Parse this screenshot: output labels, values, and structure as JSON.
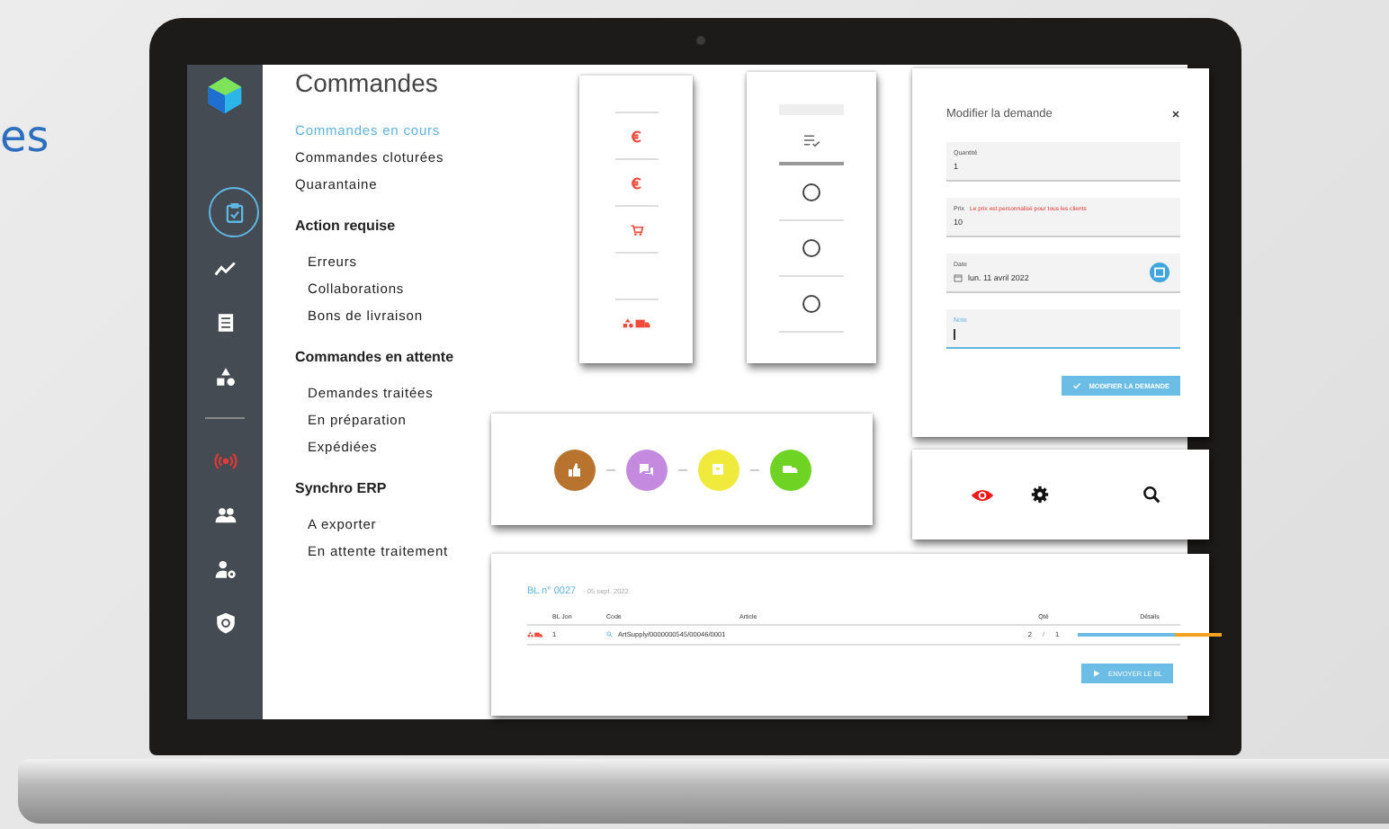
{
  "page_text": "es",
  "sidebar": {
    "groups": [
      {
        "items": [
          {
            "kind": "orders",
            "selected": true
          },
          {
            "kind": "stats",
            "selected": false
          },
          {
            "kind": "document",
            "selected": false
          },
          {
            "kind": "shapes",
            "selected": false
          }
        ]
      },
      {
        "items": [
          {
            "kind": "signal",
            "selected": false
          },
          {
            "kind": "people",
            "selected": false
          },
          {
            "kind": "user-settings",
            "selected": false
          },
          {
            "kind": "shield",
            "selected": false
          }
        ]
      }
    ]
  },
  "nav": {
    "title": "Commandes",
    "sections": [
      {
        "items": [
          {
            "label": "Commandes en cours",
            "selected": true
          },
          {
            "label": "Commandes cloturées",
            "selected": false
          },
          {
            "label": "Quarantaine",
            "selected": false
          }
        ]
      },
      {
        "heading": "Action requise",
        "items": [
          {
            "label": "Erreurs",
            "selected": false
          },
          {
            "label": "Collaborations",
            "selected": false
          },
          {
            "label": "Bons de livraison",
            "selected": false
          }
        ]
      },
      {
        "heading": "Commandes en attente",
        "items": [
          {
            "label": "Demandes traitées",
            "selected": false
          },
          {
            "label": "En préparation",
            "selected": false
          },
          {
            "label": "Expédiées",
            "selected": false
          }
        ]
      },
      {
        "heading": "Synchro ERP",
        "items": [
          {
            "label": "A exporter",
            "selected": false
          },
          {
            "label": "En attente traitement",
            "selected": false
          }
        ]
      }
    ]
  },
  "status_card": {
    "rows": [
      {
        "kind": "euro"
      },
      {
        "kind": "euro"
      },
      {
        "kind": "cart"
      },
      {
        "kind": "empty"
      },
      {
        "kind": "delivery"
      }
    ]
  },
  "select_card": {
    "rows": [
      {
        "selected": false
      },
      {
        "selected": false
      },
      {
        "selected": false
      }
    ]
  },
  "modal": {
    "title": "Modifier la demande",
    "fields": [
      {
        "kind": "text",
        "label": "Quantité",
        "value": "1",
        "focused": false
      },
      {
        "kind": "text",
        "label": "Prix",
        "hint": "Le prix est personnalisé pour tous les clients",
        "value": "10",
        "focused": false
      },
      {
        "kind": "date",
        "label": "Date",
        "value": "lun. 11 avril 2022",
        "focused": false
      },
      {
        "kind": "text",
        "label": "Note",
        "focused": true
      }
    ],
    "button": "MODIFIER LA DEMANDE"
  },
  "flow": {
    "steps": [
      {
        "kind": "thumb",
        "color": "#b8732e"
      },
      {
        "kind": "chat",
        "color": "#c48ae0"
      },
      {
        "kind": "box",
        "color": "#f0ea3c"
      },
      {
        "kind": "truck",
        "color": "#6fd324"
      }
    ]
  },
  "actions": [
    {
      "kind": "view",
      "alert": true
    },
    {
      "kind": "settings",
      "alert": false
    },
    {
      "kind": "search",
      "alert": false
    }
  ],
  "delivery": {
    "title": "BL n° 0027",
    "date": "- 05 sept. 2022",
    "columns": [
      "BL Jon",
      "Code",
      "Article",
      "Qté",
      "Détails"
    ],
    "rows": [
      {
        "line": "1",
        "code": "ArtSupply/0000000545/00046/0001",
        "qty_a": "2",
        "sep": "/",
        "qty_b": "1",
        "level": 0.67
      }
    ],
    "button": "ENVOYER LE BL"
  }
}
